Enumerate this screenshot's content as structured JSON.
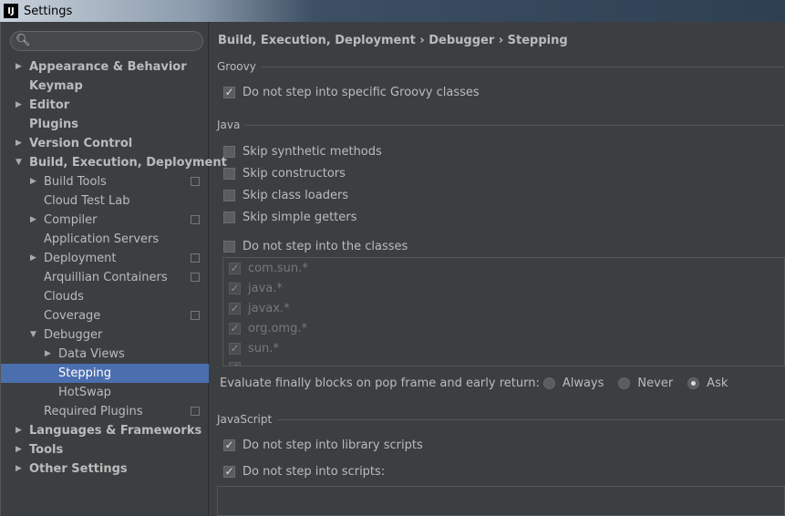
{
  "window": {
    "title": "Settings",
    "logo": "IJ"
  },
  "search": {
    "placeholder": "",
    "icon": "search-icon"
  },
  "sidebar": {
    "items": [
      {
        "label": "Appearance & Behavior",
        "level": 0,
        "bold": true,
        "arrow": "right"
      },
      {
        "label": "Keymap",
        "level": 0,
        "bold": true
      },
      {
        "label": "Editor",
        "level": 0,
        "bold": true,
        "arrow": "right"
      },
      {
        "label": "Plugins",
        "level": 0,
        "bold": true
      },
      {
        "label": "Version Control",
        "level": 0,
        "bold": true,
        "arrow": "right"
      },
      {
        "label": "Build, Execution, Deployment",
        "level": 0,
        "bold": true,
        "arrow": "down"
      },
      {
        "label": "Build Tools",
        "level": 1,
        "arrow": "right",
        "project": true
      },
      {
        "label": "Cloud Test Lab",
        "level": 1
      },
      {
        "label": "Compiler",
        "level": 1,
        "arrow": "right",
        "project": true
      },
      {
        "label": "Application Servers",
        "level": 1
      },
      {
        "label": "Deployment",
        "level": 1,
        "arrow": "right",
        "project": true
      },
      {
        "label": "Arquillian Containers",
        "level": 1,
        "project": true
      },
      {
        "label": "Clouds",
        "level": 1
      },
      {
        "label": "Coverage",
        "level": 1,
        "project": true
      },
      {
        "label": "Debugger",
        "level": 1,
        "arrow": "down"
      },
      {
        "label": "Data Views",
        "level": 2,
        "arrow": "right"
      },
      {
        "label": "Stepping",
        "level": 2,
        "selected": true
      },
      {
        "label": "HotSwap",
        "level": 2
      },
      {
        "label": "Required Plugins",
        "level": 1,
        "project": true
      },
      {
        "label": "Languages & Frameworks",
        "level": 0,
        "bold": true,
        "arrow": "right"
      },
      {
        "label": "Tools",
        "level": 0,
        "bold": true,
        "arrow": "right"
      },
      {
        "label": "Other Settings",
        "level": 0,
        "bold": true,
        "arrow": "right"
      }
    ]
  },
  "main": {
    "breadcrumb": "Build, Execution, Deployment › Debugger › Stepping",
    "groovy": {
      "title": "Groovy",
      "options": [
        {
          "label": "Do not step into specific Groovy classes",
          "checked": true
        }
      ]
    },
    "java": {
      "title": "Java",
      "options": [
        {
          "label": "Skip synthetic methods",
          "checked": false
        },
        {
          "label": "Skip constructors",
          "checked": false
        },
        {
          "label": "Skip class loaders",
          "checked": false
        },
        {
          "label": "Skip simple getters",
          "checked": false
        },
        {
          "label": "Do not step into the classes",
          "checked": false
        }
      ],
      "classes": [
        {
          "label": "com.sun.*",
          "checked": true
        },
        {
          "label": "java.*",
          "checked": true
        },
        {
          "label": "javax.*",
          "checked": true
        },
        {
          "label": "org.omg.*",
          "checked": true
        },
        {
          "label": "sun.*",
          "checked": true
        },
        {
          "label": "",
          "checked": true
        }
      ]
    },
    "evaluate": {
      "label": "Evaluate finally blocks on pop frame and early return:",
      "options": [
        "Always",
        "Never",
        "Ask"
      ],
      "selected": "Ask"
    },
    "javascript": {
      "title": "JavaScript",
      "options": [
        {
          "label": "Do not step into library scripts",
          "checked": true
        },
        {
          "label": "Do not step into scripts:",
          "checked": true
        }
      ]
    }
  },
  "colors": {
    "background": "#3c3f41",
    "selection": "#4b6eaf"
  }
}
